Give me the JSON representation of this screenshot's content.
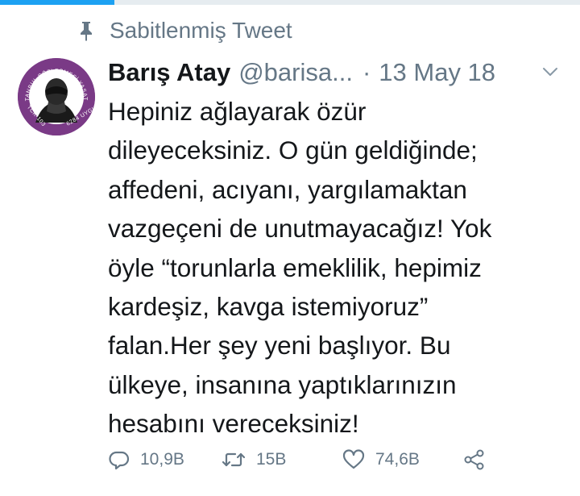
{
  "pinned_label": "Sabitlenmiş Tweet",
  "tweet": {
    "name": "Barış Atay",
    "handle": "@barisa...",
    "separator": "·",
    "date": "13 May 18",
    "text": "Hepiniz ağlayarak özür\ndileyeceksiniz. O gün geldiğinde;\naffedeni, acıyanı, yargılamaktan\nvazgeçeni de unutmayacağız! Yok\nöyle “torunlarla emeklilik, hepimiz\nkardeşiz, kavga istemiyoruz”\nfalan.Her şey yeni başlıyor. Bu\nülkeye, insanına yaptıklarınızın\nhesabını vereceksiniz!"
  },
  "avatar": {
    "text_top": "İSTANBUL SÖZLEŞMESİ YAŞATIR",
    "text_left": "TCK-103",
    "text_right": "6284 UYGULA"
  },
  "actions": {
    "replies": "10,9B",
    "retweets": "15B",
    "likes": "74,6B"
  },
  "icons": [
    "pin-icon",
    "chevron-down-icon",
    "reply-icon",
    "retweet-icon",
    "like-icon",
    "share-icon"
  ],
  "colors": {
    "accent": "#1da1f2",
    "muted": "#657786",
    "text": "#14171a",
    "avatar_bg": "#7a3a86"
  }
}
